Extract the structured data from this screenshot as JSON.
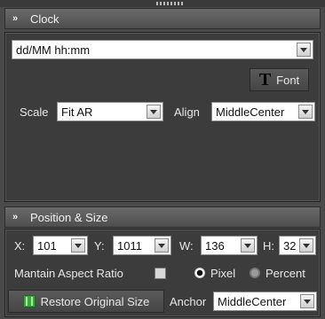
{
  "clock_section": {
    "header_title": "Clock",
    "format_value": "dd/MM  hh:mm",
    "font_button_label": "Font",
    "scale_label": "Scale",
    "scale_value": "Fit AR",
    "align_label": "Align",
    "align_value": "MiddleCenter"
  },
  "position_section": {
    "header_title": "Position & Size",
    "x_label": "X:",
    "x_value": "101",
    "y_label": "Y:",
    "y_value": "1011",
    "w_label": "W:",
    "w_value": "136",
    "h_label": "H:",
    "h_value": "32",
    "aspect_label": "Mantain Aspect Ratio",
    "pixel_label": "Pixel",
    "percent_label": "Percent",
    "restore_label": "Restore Original Size",
    "anchor_label": "Anchor",
    "anchor_value": "MiddleCenter"
  },
  "icons": {
    "collapse": "chevron-up-icon",
    "font": "font-T-icon",
    "restore": "restore-size-icon"
  }
}
